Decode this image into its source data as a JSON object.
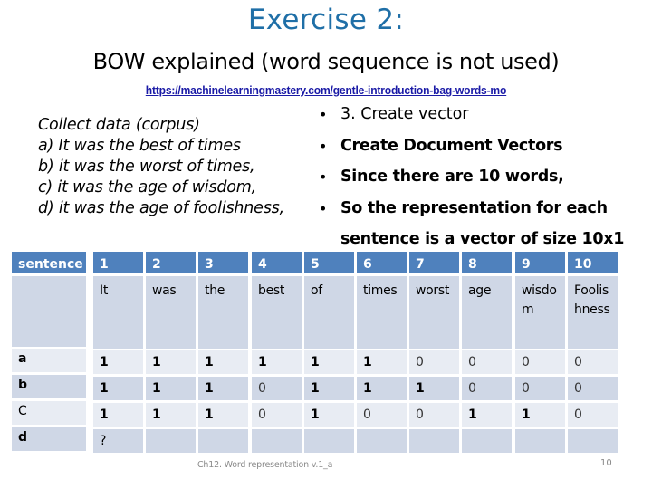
{
  "slide": {
    "title": "Exercise  2:",
    "subtitle": "BOW explained (word sequence is not used)",
    "link": "https://machinelearningmastery.com/gentle-introduction-bag-words-mo",
    "corpus": [
      "Collect data (corpus)",
      "a) It was the best of times",
      "b) it was the worst of times,",
      "c) it was the age of wisdom,",
      "d) it was the age of foolishness,"
    ],
    "bullets": [
      {
        "text": "3. Create vector",
        "bold": false
      },
      {
        "text": "Create Document Vectors",
        "bold": true
      },
      {
        "text": "Since there are 10 words,",
        "bold": true
      },
      {
        "text": "So the representation for each",
        "bold": true,
        "continuation": "sentence is a vector of size 10x1"
      }
    ],
    "bullet_glyph": "•",
    "footer": "Ch12.  Word  representation v.1_a",
    "page_number": "10"
  },
  "table": {
    "row_header_label": "sentence",
    "column_indices": [
      "1",
      "2",
      "3",
      "4",
      "5",
      "6",
      "7",
      "8",
      "9",
      "10"
    ],
    "vocabulary": [
      "It",
      "was",
      "the",
      "best",
      "of",
      "times",
      "worst",
      "age",
      "wisdo\nm",
      "Foolis\nhness"
    ],
    "rows": [
      {
        "label": "a",
        "values": [
          "1",
          "1",
          "1",
          "1",
          "1",
          "1",
          "0",
          "0",
          "0",
          "0"
        ]
      },
      {
        "label": "b",
        "values": [
          "1",
          "1",
          "1",
          "0",
          "1",
          "1",
          "1",
          "0",
          "0",
          "0"
        ]
      },
      {
        "label": "C",
        "values": [
          "1",
          "1",
          "1",
          "0",
          "1",
          "0",
          "0",
          "1",
          "1",
          "0"
        ]
      },
      {
        "label": "d",
        "values": [
          "?",
          "",
          "",
          "",
          "",
          "",
          "",
          "",
          "",
          ""
        ]
      }
    ]
  },
  "colors": {
    "title": "#1f6fa7",
    "header_fill": "#4f81bd",
    "row_dark": "#cfd7e6",
    "row_light": "#e8ecf3",
    "link": "#1a1aa6"
  }
}
